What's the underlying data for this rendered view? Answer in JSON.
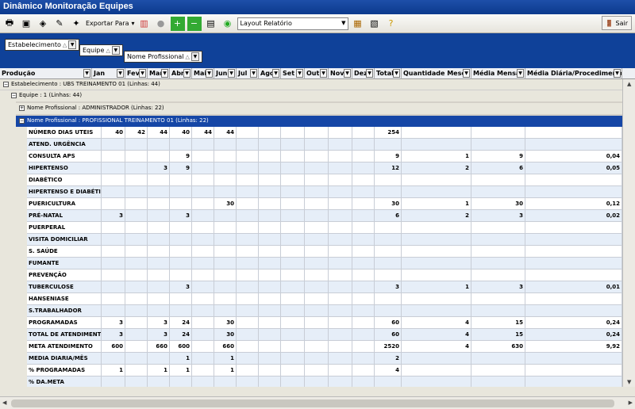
{
  "window": {
    "title": "Dinâmico Monitoração Equipes"
  },
  "toolbar": {
    "export_label": "Exportar Para",
    "layout_label": "Layout Relatório",
    "exit_label": "Sair"
  },
  "groups": {
    "chip1": "Estabelecimento",
    "chip2": "Equipe",
    "chip3": "Nome Profissional"
  },
  "columns": [
    "Produção",
    "Jan",
    "Fev",
    "Mar",
    "Abr",
    "Mai",
    "Jun",
    "Jul",
    "Ago",
    "Set",
    "Out",
    "Nov",
    "Dez",
    "Total",
    "Quantidade Meses",
    "Média Mensal",
    "Média Diária/Procedimento"
  ],
  "tree": {
    "estab": "Estabelecimento : UBS TREINAMENTO 01 (Linhas: 44)",
    "equipe": "Equipe : 1 (Linhas: 44)",
    "prof1": "Nome Profissional : ADMINISTRADOR (Linhas: 22)",
    "prof2": "Nome Profissional : PROFISSIONAL TREINAMENTO 01 (Linhas: 22)"
  },
  "rows": [
    [
      "NÚMERO DIAS UTEIS",
      "40",
      "42",
      "44",
      "40",
      "44",
      "44",
      "",
      "",
      "",
      "",
      "",
      "",
      "254",
      "",
      "",
      ""
    ],
    [
      "ATEND. URGÊNCIA",
      "",
      "",
      "",
      "",
      "",
      "",
      "",
      "",
      "",
      "",
      "",
      "",
      "",
      "",
      "",
      ""
    ],
    [
      "CONSULTA APS",
      "",
      "",
      "",
      "9",
      "",
      "",
      "",
      "",
      "",
      "",
      "",
      "",
      "9",
      "1",
      "9",
      "0,04"
    ],
    [
      "HIPERTENSO",
      "",
      "",
      "3",
      "9",
      "",
      "",
      "",
      "",
      "",
      "",
      "",
      "",
      "12",
      "2",
      "6",
      "0,05"
    ],
    [
      "DIABÉTICO",
      "",
      "",
      "",
      "",
      "",
      "",
      "",
      "",
      "",
      "",
      "",
      "",
      "",
      "",
      "",
      ""
    ],
    [
      "HIPERTENSO E DIABÉTICO",
      "",
      "",
      "",
      "",
      "",
      "",
      "",
      "",
      "",
      "",
      "",
      "",
      "",
      "",
      "",
      ""
    ],
    [
      "PUERICULTURA",
      "",
      "",
      "",
      "",
      "",
      "30",
      "",
      "",
      "",
      "",
      "",
      "",
      "30",
      "1",
      "30",
      "0,12"
    ],
    [
      "PRÉ-NATAL",
      "3",
      "",
      "",
      "3",
      "",
      "",
      "",
      "",
      "",
      "",
      "",
      "",
      "6",
      "2",
      "3",
      "0,02"
    ],
    [
      "PUERPERAL",
      "",
      "",
      "",
      "",
      "",
      "",
      "",
      "",
      "",
      "",
      "",
      "",
      "",
      "",
      "",
      ""
    ],
    [
      "VISITA DOMICILIAR",
      "",
      "",
      "",
      "",
      "",
      "",
      "",
      "",
      "",
      "",
      "",
      "",
      "",
      "",
      "",
      ""
    ],
    [
      "S. SAÚDE",
      "",
      "",
      "",
      "",
      "",
      "",
      "",
      "",
      "",
      "",
      "",
      "",
      "",
      "",
      "",
      ""
    ],
    [
      "FUMANTE",
      "",
      "",
      "",
      "",
      "",
      "",
      "",
      "",
      "",
      "",
      "",
      "",
      "",
      "",
      "",
      ""
    ],
    [
      "PREVENÇÃO",
      "",
      "",
      "",
      "",
      "",
      "",
      "",
      "",
      "",
      "",
      "",
      "",
      "",
      "",
      "",
      ""
    ],
    [
      "TUBERCULOSE",
      "",
      "",
      "",
      "3",
      "",
      "",
      "",
      "",
      "",
      "",
      "",
      "",
      "3",
      "1",
      "3",
      "0,01"
    ],
    [
      "HANSENIASE",
      "",
      "",
      "",
      "",
      "",
      "",
      "",
      "",
      "",
      "",
      "",
      "",
      "",
      "",
      "",
      ""
    ],
    [
      "S.TRABALHADOR",
      "",
      "",
      "",
      "",
      "",
      "",
      "",
      "",
      "",
      "",
      "",
      "",
      "",
      "",
      "",
      ""
    ],
    [
      "PROGRAMADAS",
      "3",
      "",
      "3",
      "24",
      "",
      "30",
      "",
      "",
      "",
      "",
      "",
      "",
      "60",
      "4",
      "15",
      "0,24"
    ],
    [
      "TOTAL DE ATENDIMENTO",
      "3",
      "",
      "3",
      "24",
      "",
      "30",
      "",
      "",
      "",
      "",
      "",
      "",
      "60",
      "4",
      "15",
      "0,24"
    ],
    [
      "META ATENDIMENTO",
      "600",
      "",
      "660",
      "600",
      "",
      "660",
      "",
      "",
      "",
      "",
      "",
      "",
      "2520",
      "4",
      "630",
      "9,92"
    ],
    [
      "MEDIA DIARIA/MÊS",
      "",
      "",
      "",
      "1",
      "",
      "1",
      "",
      "",
      "",
      "",
      "",
      "",
      "2",
      "",
      "",
      ""
    ],
    [
      "% PROGRAMADAS",
      "1",
      "",
      "1",
      "1",
      "",
      "1",
      "",
      "",
      "",
      "",
      "",
      "",
      "4",
      "",
      "",
      ""
    ],
    [
      "% DA.META",
      "",
      "",
      "",
      "",
      "",
      "",
      "",
      "",
      "",
      "",
      "",
      "",
      "",
      "",
      "",
      ""
    ]
  ]
}
